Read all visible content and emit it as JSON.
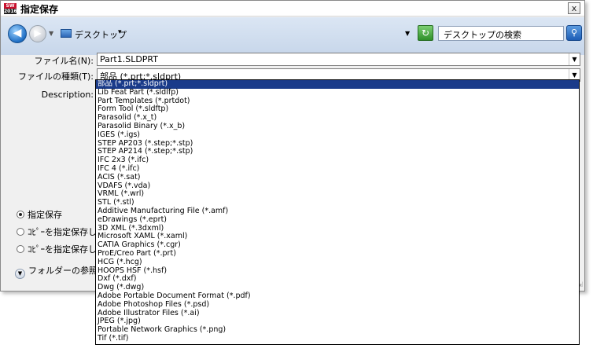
{
  "window": {
    "title": "指定保存",
    "app_icon_top": "SW",
    "app_icon_year": "2016",
    "close_label": "x"
  },
  "nav": {
    "back_icon": "arrow-left-icon",
    "forward_icon": "arrow-right-icon",
    "address": "デスクトップ",
    "search_placeholder": "デスクトップの検索"
  },
  "form": {
    "filename_label": "ファイル名(N):",
    "filename_value": "Part1.SLDPRT",
    "filetype_label": "ファイルの種類(T):",
    "filetype_value": "部品 (*.prt;*.sldprt)",
    "description_label": "Description:"
  },
  "options": [
    {
      "label": "指定保存",
      "checked": true
    },
    {
      "label": "ｺﾋﾟｰを指定保存し",
      "checked": false
    },
    {
      "label": "ｺﾋﾟｰを指定保存し",
      "checked": false
    }
  ],
  "folder_browse_label": "フォルダーの参照(B)",
  "file_types": [
    "部品 (*.prt;*.sldprt)",
    "Lib Feat Part (*.sldlfp)",
    "Part Templates (*.prtdot)",
    "Form Tool (*.sldftp)",
    "Parasolid (*.x_t)",
    "Parasolid Binary (*.x_b)",
    "IGES (*.igs)",
    "STEP AP203 (*.step;*.stp)",
    "STEP AP214 (*.step;*.stp)",
    "IFC 2x3 (*.ifc)",
    "IFC 4 (*.ifc)",
    "ACIS (*.sat)",
    "VDAFS (*.vda)",
    "VRML (*.wrl)",
    "STL (*.stl)",
    "Additive Manufacturing File (*.amf)",
    "eDrawings (*.eprt)",
    "3D XML (*.3dxml)",
    "Microsoft XAML (*.xaml)",
    "CATIA Graphics (*.cgr)",
    "ProE/Creo Part (*.prt)",
    "HCG (*.hcg)",
    "HOOPS HSF (*.hsf)",
    "Dxf (*.dxf)",
    "Dwg (*.dwg)",
    "Adobe Portable Document Format (*.pdf)",
    "Adobe Photoshop Files (*.psd)",
    "Adobe Illustrator Files (*.ai)",
    "JPEG (*.jpg)",
    "Portable Network Graphics (*.png)",
    "Tif (*.tif)"
  ],
  "selected_index": 0,
  "colors": {
    "selection": "#1a3b8a",
    "toolbar": "#c7d6ea",
    "dialog": "#f0f0f0"
  }
}
